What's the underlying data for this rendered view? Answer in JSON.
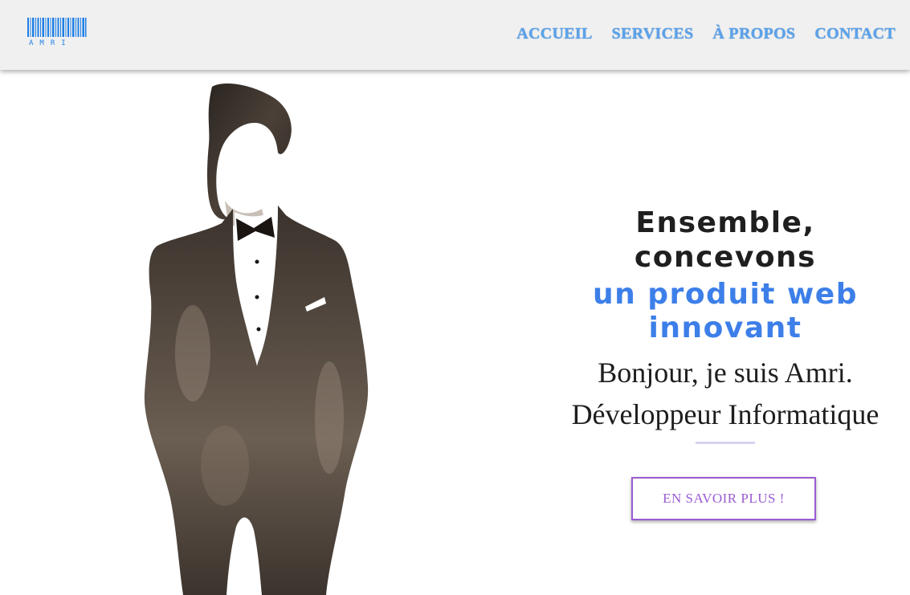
{
  "brand": {
    "logo_icon": "barcode-icon",
    "logo_text": "AMRI",
    "color": "#1f7fe6"
  },
  "nav": {
    "items": [
      {
        "label": "ACCUEIL"
      },
      {
        "label": "SERVICES"
      },
      {
        "label": "À PROPOS"
      },
      {
        "label": "CONTACT"
      }
    ],
    "color": "#5ba2ea"
  },
  "hero": {
    "image": "tuxedo-man-watercolor-illustration",
    "headline_line1": "Ensemble,",
    "headline_line2": "concevons",
    "accent_line1": "un produit web",
    "accent_line2": "innovant",
    "intro_line1": "Bonjour, je suis Amri.",
    "intro_line2": "Développeur Informatique",
    "accent_color": "#3d7fe9",
    "cta_label": "EN SAVOIR PLUS !",
    "cta_color": "#9a5cd2"
  }
}
